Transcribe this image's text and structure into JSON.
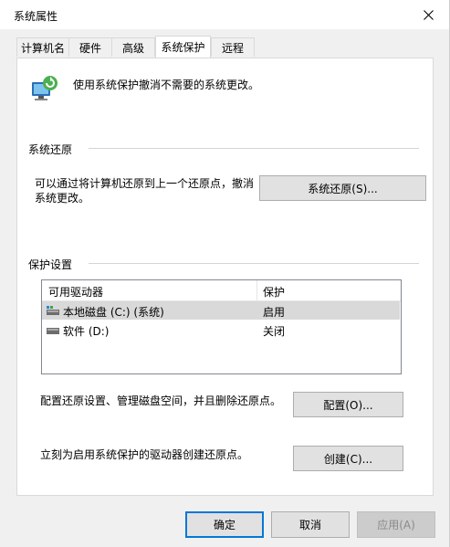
{
  "window": {
    "title": "系统属性"
  },
  "tabs": [
    {
      "label": "计算机名"
    },
    {
      "label": "硬件"
    },
    {
      "label": "高级"
    },
    {
      "label": "系统保护",
      "active": true
    },
    {
      "label": "远程"
    }
  ],
  "intro": {
    "text": "使用系统保护撤消不需要的系统更改。",
    "icon": "shield-computer-icon"
  },
  "restore": {
    "group_label": "系统还原",
    "description_line1": "可以通过将计算机还原到上一个还原点，撤消",
    "description_line2": "系统更改。",
    "button_label": "系统还原(S)..."
  },
  "protection": {
    "group_label": "保护设置",
    "columns": [
      "可用驱动器",
      "保护"
    ],
    "rows": [
      {
        "drive": "本地磁盘 (C:) (系统)",
        "status": "启用",
        "icon": "system-drive-icon",
        "selected": true
      },
      {
        "drive": "软件 (D:)",
        "status": "关闭",
        "icon": "drive-icon",
        "selected": false
      }
    ],
    "configure_text": "配置还原设置、管理磁盘空间，并且删除还原点。",
    "configure_button": "配置(O)...",
    "create_text": "立刻为启用系统保护的驱动器创建还原点。",
    "create_button": "创建(C)..."
  },
  "footer": {
    "ok": "确定",
    "cancel": "取消",
    "apply": "应用(A)"
  },
  "colors": {
    "default_button_border": "#0078d7",
    "selected_row": "#d9d9d9"
  }
}
